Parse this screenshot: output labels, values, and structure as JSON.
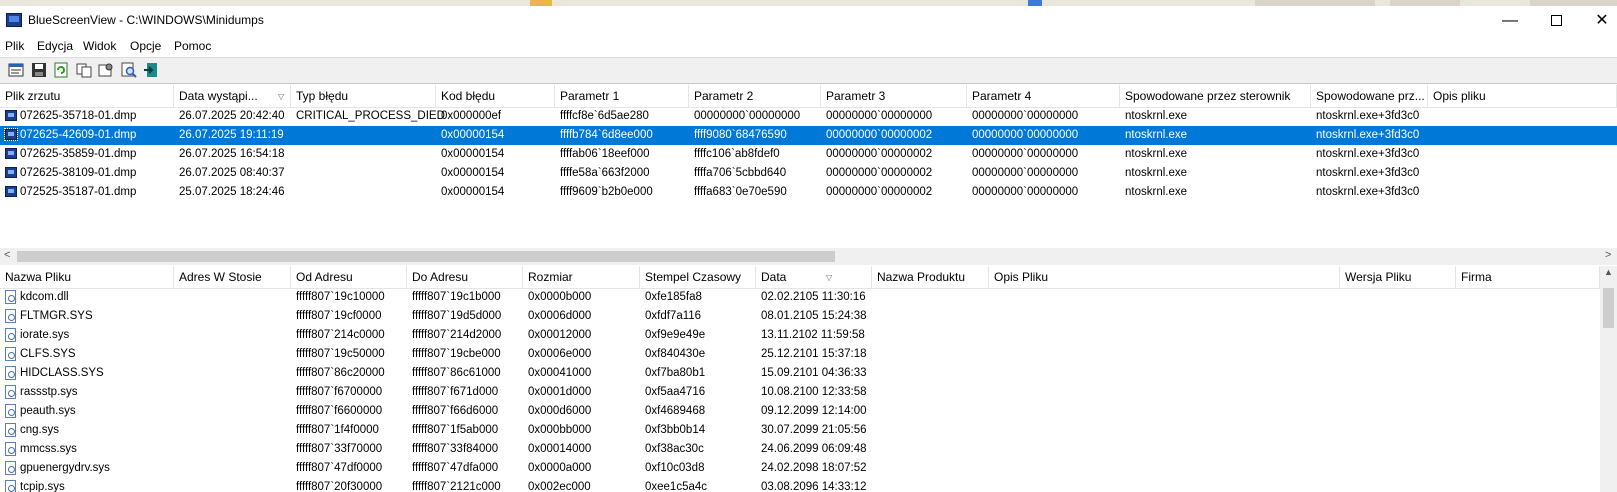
{
  "window": {
    "title": "BlueScreenView  -  C:\\WINDOWS\\Minidumps"
  },
  "menu": [
    "Plik",
    "Edycja",
    "Widok",
    "Opcje",
    "Pomoc"
  ],
  "toolbar_icons": [
    "properties-icon",
    "save-icon",
    "refresh-icon",
    "copy-icon",
    "options-icon",
    "find-icon",
    "exit-icon"
  ],
  "top_table": {
    "columns": [
      "Plik zrzutu",
      "Data wystąpi...",
      "Typ błędu",
      "Kod błędu",
      "Parametr 1",
      "Parametr 2",
      "Parametr 3",
      "Parametr 4",
      "Spowodowane przez sterownik",
      "Spowodowane prz...",
      "Opis pliku"
    ],
    "rows": [
      [
        "072625-35718-01.dmp",
        "26.07.2025 20:42:40",
        "CRITICAL_PROCESS_DIED",
        "0x000000ef",
        "ffffcf8e`6d5ae280",
        "00000000`00000000",
        "00000000`00000000",
        "00000000`00000000",
        "ntoskrnl.exe",
        "ntoskrnl.exe+3fd3c0"
      ],
      [
        "072625-42609-01.dmp",
        "26.07.2025 19:11:19",
        "",
        "0x00000154",
        "ffffb784`6d8ee000",
        "ffff9080`68476590",
        "00000000`00000002",
        "00000000`00000000",
        "ntoskrnl.exe",
        "ntoskrnl.exe+3fd3c0"
      ],
      [
        "072625-35859-01.dmp",
        "26.07.2025 16:54:18",
        "",
        "0x00000154",
        "ffffab06`18eef000",
        "ffffc106`ab8fdef0",
        "00000000`00000002",
        "00000000`00000000",
        "ntoskrnl.exe",
        "ntoskrnl.exe+3fd3c0"
      ],
      [
        "072625-38109-01.dmp",
        "26.07.2025 08:40:37",
        "",
        "0x00000154",
        "ffffe58a`663f2000",
        "ffffa706`5cbbd640",
        "00000000`00000002",
        "00000000`00000000",
        "ntoskrnl.exe",
        "ntoskrnl.exe+3fd3c0"
      ],
      [
        "072525-35187-01.dmp",
        "25.07.2025 18:24:46",
        "",
        "0x00000154",
        "ffff9609`b2b0e000",
        "ffffa683`0e70e590",
        "00000000`00000002",
        "00000000`00000000",
        "ntoskrnl.exe",
        "ntoskrnl.exe+3fd3c0"
      ]
    ],
    "selected_index": 1
  },
  "bottom_table": {
    "columns": [
      "Nazwa Pliku",
      "Adres W Stosie",
      "Od Adresu",
      "Do Adresu",
      "Rozmiar",
      "Stempel Czasowy",
      "Data",
      "Nazwa Produktu",
      "Opis Pliku",
      "Wersja Pliku",
      "Firma"
    ],
    "rows": [
      [
        "kdcom.dll",
        "",
        "fffff807`19c10000",
        "fffff807`19c1b000",
        "0x0000b000",
        "0xfe185fa8",
        "02.02.2105 11:30:16"
      ],
      [
        "FLTMGR.SYS",
        "",
        "fffff807`19cf0000",
        "fffff807`19d5d000",
        "0x0006d000",
        "0xfdf7a116",
        "08.01.2105 15:24:38"
      ],
      [
        "iorate.sys",
        "",
        "fffff807`214c0000",
        "fffff807`214d2000",
        "0x00012000",
        "0xf9e9e49e",
        "13.11.2102 11:59:58"
      ],
      [
        "CLFS.SYS",
        "",
        "fffff807`19c50000",
        "fffff807`19cbe000",
        "0x0006e000",
        "0xf840430e",
        "25.12.2101 15:37:18"
      ],
      [
        "HIDCLASS.SYS",
        "",
        "fffff807`86c20000",
        "fffff807`86c61000",
        "0x00041000",
        "0xf7ba80b1",
        "15.09.2101 04:36:33"
      ],
      [
        "rassstp.sys",
        "",
        "fffff807`f6700000",
        "fffff807`f671d000",
        "0x0001d000",
        "0xf5aa4716",
        "10.08.2100 12:33:58"
      ],
      [
        "peauth.sys",
        "",
        "fffff807`f6600000",
        "fffff807`f66d6000",
        "0x000d6000",
        "0xf4689468",
        "09.12.2099 12:14:00"
      ],
      [
        "cng.sys",
        "",
        "fffff807`1f4f0000",
        "fffff807`1f5ab000",
        "0x000bb000",
        "0xf3bb0b14",
        "30.07.2099 21:05:56"
      ],
      [
        "mmcss.sys",
        "",
        "fffff807`33f70000",
        "fffff807`33f84000",
        "0x00014000",
        "0xf38ac30c",
        "24.06.2099 06:09:48"
      ],
      [
        "gpuenergydrv.sys",
        "",
        "fffff807`47df0000",
        "fffff807`47dfa000",
        "0x0000a000",
        "0xf10c03d8",
        "24.02.2098 18:07:52"
      ],
      [
        "tcpip.sys",
        "",
        "fffff807`20f30000",
        "fffff807`2121c000",
        "0x002ec000",
        "0xee1c5a4c",
        "03.08.2096 14:33:12"
      ]
    ]
  }
}
